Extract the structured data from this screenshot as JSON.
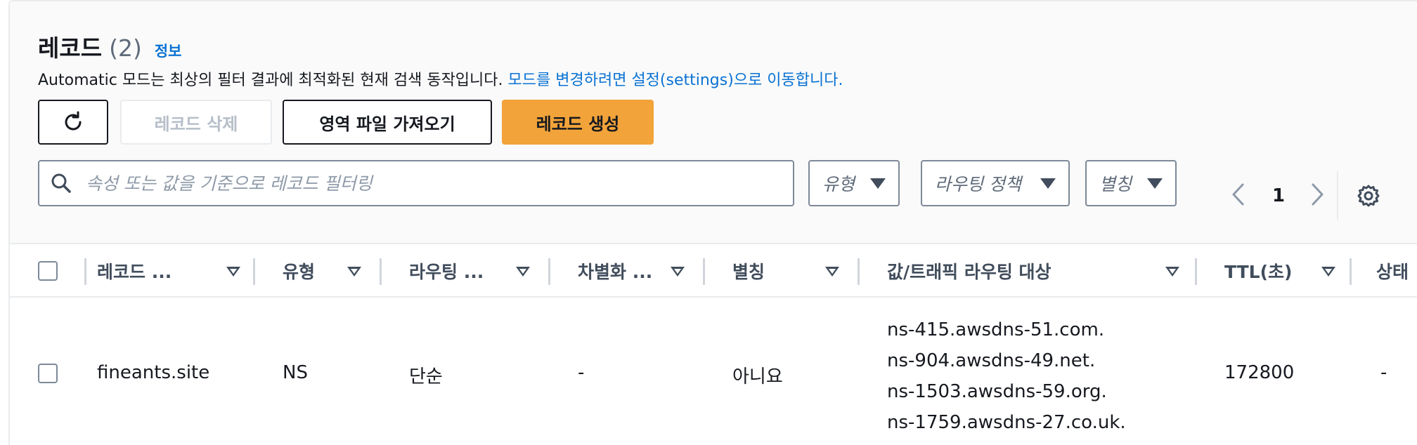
{
  "header": {
    "title": "레코드",
    "count": "(2)",
    "info_link": "정보",
    "description_prefix": "Automatic 모드는 최상의 필터 결과에 최적화된 현재 검색 동작입니다. ",
    "description_link": "모드를 변경하려면 설정(settings)으로 이동합니다."
  },
  "actions": {
    "refresh_icon": "refresh-icon",
    "delete_label": "레코드 삭제",
    "import_label": "영역 파일 가져오기",
    "create_label": "레코드 생성"
  },
  "filters": {
    "search_placeholder": "속성 또는 값을 기준으로 레코드 필터링",
    "search_value": "",
    "type_label": "유형",
    "routing_label": "라우팅 정책",
    "alias_label": "별칭"
  },
  "pagination": {
    "current_page": "1"
  },
  "table": {
    "columns": [
      "레코드 ...",
      "유형",
      "라우팅 ...",
      "차별화 ...",
      "별칭",
      "값/트래픽 라우팅 대상",
      "TTL(초)",
      "상태"
    ],
    "rows": [
      {
        "name": "fineants.site",
        "type": "NS",
        "routing": "단순",
        "differentiator": "-",
        "alias": "아니요",
        "values": [
          "ns-415.awsdns-51.com.",
          "ns-904.awsdns-49.net.",
          "ns-1503.awsdns-59.org.",
          "ns-1759.awsdns-27.co.uk."
        ],
        "ttl": "172800",
        "status": "-"
      }
    ]
  },
  "colors": {
    "primary": "#f2a33a",
    "link": "#0972d3",
    "text": "#16191f",
    "muted": "#5f6b7a",
    "disabled": "#b6bec9"
  }
}
